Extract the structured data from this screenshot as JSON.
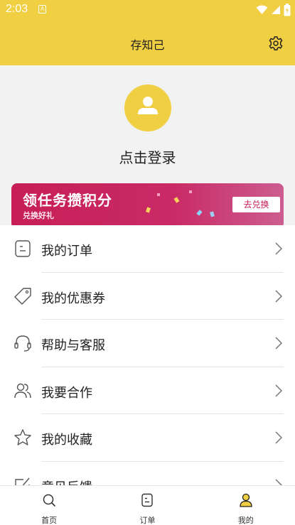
{
  "status_bar": {
    "time": "2:03",
    "notification_letter": "A"
  },
  "header": {
    "title": "存知己"
  },
  "profile": {
    "login_label": "点击登录"
  },
  "banner": {
    "title": "领任务攒积分",
    "subtitle": "兑换好礼",
    "button_label": "去兑换",
    "accent_color": "#c71e57"
  },
  "menu": {
    "items": [
      {
        "label": "我的订单",
        "icon": "order-icon"
      },
      {
        "label": "我的优惠券",
        "icon": "coupon-icon"
      },
      {
        "label": "帮助与客服",
        "icon": "headset-icon"
      },
      {
        "label": "我要合作",
        "icon": "partners-icon"
      },
      {
        "label": "我的收藏",
        "icon": "star-icon"
      },
      {
        "label": "意见反馈",
        "icon": "feedback-icon"
      }
    ]
  },
  "tabbar": {
    "tabs": [
      {
        "label": "首页",
        "icon": "search-icon"
      },
      {
        "label": "订单",
        "icon": "order-icon"
      },
      {
        "label": "我的",
        "icon": "person-icon",
        "active": true
      }
    ]
  },
  "theme": {
    "primary_color": "#f1cf42",
    "text_color": "#222222"
  }
}
